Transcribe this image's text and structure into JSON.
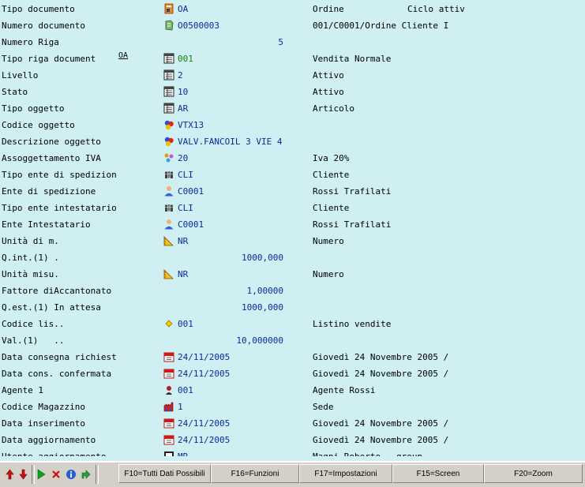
{
  "rows": [
    {
      "label": "Tipo documento",
      "icon": "document-type-icon",
      "value": "OA",
      "desc": "Ordine",
      "extra": "Ciclo attiv"
    },
    {
      "label": "Numero documento",
      "icon": "document-number-icon",
      "value": "O0500003",
      "desc": "001/C0001/Ordine Cliente I"
    },
    {
      "label": "Numero Riga",
      "number": "5"
    },
    {
      "label": "Tipo riga document",
      "sup": "OA",
      "icon": "table-icon",
      "value": "001",
      "desc": "Vendita Normale"
    },
    {
      "label": "Livello",
      "icon": "table-icon",
      "value": "2",
      "desc": "Attivo"
    },
    {
      "label": "Stato",
      "icon": "table-icon",
      "value": "10",
      "desc": "Attivo"
    },
    {
      "label": "Tipo oggetto",
      "icon": "table-icon",
      "value": "AR",
      "desc": "Articolo"
    },
    {
      "label": "Codice oggetto",
      "icon": "balls-icon",
      "value": "VTX13"
    },
    {
      "label": "Descrizione oggetto",
      "icon": "balls-icon",
      "value": "VALV.FANCOIL 3 VIE 4"
    },
    {
      "label": "Assoggettamento IVA",
      "icon": "tax-icon",
      "value": "20",
      "desc": "Iva 20%"
    },
    {
      "label": "Tipo ente di spedizion",
      "icon": "people-icon",
      "value": "CLI",
      "desc": "Cliente"
    },
    {
      "label": "Ente di spedizione",
      "icon": "person-icon",
      "value": "C0001",
      "desc": "Rossi Trafilati"
    },
    {
      "label": "Tipo ente intestatario",
      "icon": "people-icon",
      "value": "CLI",
      "desc": "Cliente"
    },
    {
      "label": "Ente Intestatario",
      "icon": "person-icon",
      "value": "C0001",
      "desc": "Rossi Trafilati"
    },
    {
      "label": "Unità di m.",
      "icon": "ruler-icon",
      "value": "NR",
      "desc": "Numero"
    },
    {
      "label": "Q.int.(1) .",
      "number": "1000,000"
    },
    {
      "label": "Unità misu.",
      "icon": "ruler-icon",
      "value": "NR",
      "desc": "Numero"
    },
    {
      "label": "Fattore diAccantonato",
      "number": "1,00000"
    },
    {
      "label": "Q.est.(1) In attesa",
      "number": "1000,000"
    },
    {
      "label": "Codice lis..",
      "icon": "diamond-icon",
      "value": "001",
      "desc": "Listino vendite"
    },
    {
      "label": "Val.(1)   ..",
      "number": "10,000000"
    },
    {
      "label": "Data consegna richiest",
      "icon": "calendar-icon",
      "value": "24/11/2005",
      "desc": "Giovedì 24 Novembre 2005 /"
    },
    {
      "label": "Data cons. confermata",
      "icon": "calendar-icon",
      "value": "24/11/2005",
      "desc": "Giovedì 24 Novembre 2005 /"
    },
    {
      "label": "Agente 1",
      "icon": "agent-icon",
      "value": "001",
      "desc": "Agente Rossi"
    },
    {
      "label": "Codice Magazzino",
      "icon": "warehouse-icon",
      "value": "1",
      "desc": "Sede"
    },
    {
      "label": "Data inserimento",
      "icon": "calendar-icon",
      "value": "24/11/2005",
      "desc": "Giovedì 24 Novembre 2005 /"
    },
    {
      "label": "Data aggiornamento",
      "icon": "calendar-icon",
      "value": "24/11/2005",
      "desc": "Giovedì 24 Novembre 2005 /"
    },
    {
      "label": "Utente aggiornamento",
      "icon": "user-icon",
      "value": "MR",
      "desc": "Magni Roberto   group"
    }
  ],
  "toolbar": {
    "icons": [
      "arrow-up-icon",
      "arrow-down-icon",
      "play-icon",
      "close-icon",
      "info-icon",
      "export-icon"
    ],
    "fkeys": [
      "F10=Tutti Dati Possibili",
      "F16=Funzioni",
      "F17=Impostazioni",
      "F15=Screen",
      "F20=Zoom"
    ]
  }
}
